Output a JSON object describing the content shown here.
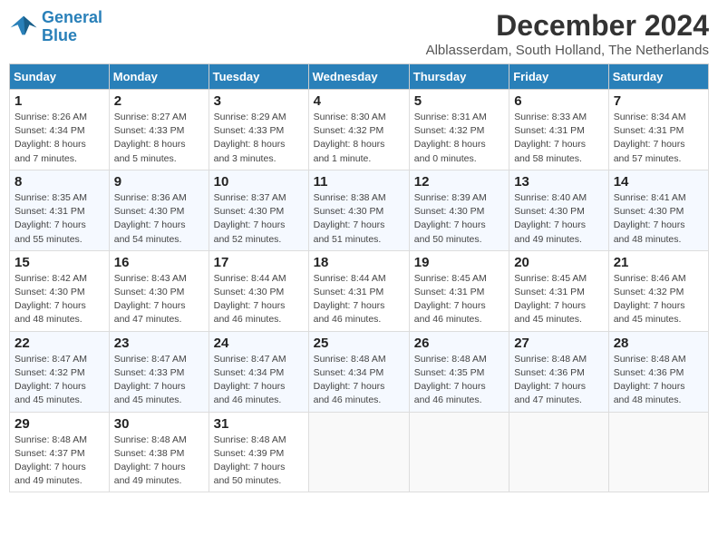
{
  "header": {
    "logo_line1": "General",
    "logo_line2": "Blue",
    "month_title": "December 2024",
    "subtitle": "Alblasserdam, South Holland, The Netherlands"
  },
  "weekdays": [
    "Sunday",
    "Monday",
    "Tuesday",
    "Wednesday",
    "Thursday",
    "Friday",
    "Saturday"
  ],
  "weeks": [
    [
      {
        "day": "1",
        "lines": [
          "Sunrise: 8:26 AM",
          "Sunset: 4:34 PM",
          "Daylight: 8 hours",
          "and 7 minutes."
        ]
      },
      {
        "day": "2",
        "lines": [
          "Sunrise: 8:27 AM",
          "Sunset: 4:33 PM",
          "Daylight: 8 hours",
          "and 5 minutes."
        ]
      },
      {
        "day": "3",
        "lines": [
          "Sunrise: 8:29 AM",
          "Sunset: 4:33 PM",
          "Daylight: 8 hours",
          "and 3 minutes."
        ]
      },
      {
        "day": "4",
        "lines": [
          "Sunrise: 8:30 AM",
          "Sunset: 4:32 PM",
          "Daylight: 8 hours",
          "and 1 minute."
        ]
      },
      {
        "day": "5",
        "lines": [
          "Sunrise: 8:31 AM",
          "Sunset: 4:32 PM",
          "Daylight: 8 hours",
          "and 0 minutes."
        ]
      },
      {
        "day": "6",
        "lines": [
          "Sunrise: 8:33 AM",
          "Sunset: 4:31 PM",
          "Daylight: 7 hours",
          "and 58 minutes."
        ]
      },
      {
        "day": "7",
        "lines": [
          "Sunrise: 8:34 AM",
          "Sunset: 4:31 PM",
          "Daylight: 7 hours",
          "and 57 minutes."
        ]
      }
    ],
    [
      {
        "day": "8",
        "lines": [
          "Sunrise: 8:35 AM",
          "Sunset: 4:31 PM",
          "Daylight: 7 hours",
          "and 55 minutes."
        ]
      },
      {
        "day": "9",
        "lines": [
          "Sunrise: 8:36 AM",
          "Sunset: 4:30 PM",
          "Daylight: 7 hours",
          "and 54 minutes."
        ]
      },
      {
        "day": "10",
        "lines": [
          "Sunrise: 8:37 AM",
          "Sunset: 4:30 PM",
          "Daylight: 7 hours",
          "and 52 minutes."
        ]
      },
      {
        "day": "11",
        "lines": [
          "Sunrise: 8:38 AM",
          "Sunset: 4:30 PM",
          "Daylight: 7 hours",
          "and 51 minutes."
        ]
      },
      {
        "day": "12",
        "lines": [
          "Sunrise: 8:39 AM",
          "Sunset: 4:30 PM",
          "Daylight: 7 hours",
          "and 50 minutes."
        ]
      },
      {
        "day": "13",
        "lines": [
          "Sunrise: 8:40 AM",
          "Sunset: 4:30 PM",
          "Daylight: 7 hours",
          "and 49 minutes."
        ]
      },
      {
        "day": "14",
        "lines": [
          "Sunrise: 8:41 AM",
          "Sunset: 4:30 PM",
          "Daylight: 7 hours",
          "and 48 minutes."
        ]
      }
    ],
    [
      {
        "day": "15",
        "lines": [
          "Sunrise: 8:42 AM",
          "Sunset: 4:30 PM",
          "Daylight: 7 hours",
          "and 48 minutes."
        ]
      },
      {
        "day": "16",
        "lines": [
          "Sunrise: 8:43 AM",
          "Sunset: 4:30 PM",
          "Daylight: 7 hours",
          "and 47 minutes."
        ]
      },
      {
        "day": "17",
        "lines": [
          "Sunrise: 8:44 AM",
          "Sunset: 4:30 PM",
          "Daylight: 7 hours",
          "and 46 minutes."
        ]
      },
      {
        "day": "18",
        "lines": [
          "Sunrise: 8:44 AM",
          "Sunset: 4:31 PM",
          "Daylight: 7 hours",
          "and 46 minutes."
        ]
      },
      {
        "day": "19",
        "lines": [
          "Sunrise: 8:45 AM",
          "Sunset: 4:31 PM",
          "Daylight: 7 hours",
          "and 46 minutes."
        ]
      },
      {
        "day": "20",
        "lines": [
          "Sunrise: 8:45 AM",
          "Sunset: 4:31 PM",
          "Daylight: 7 hours",
          "and 45 minutes."
        ]
      },
      {
        "day": "21",
        "lines": [
          "Sunrise: 8:46 AM",
          "Sunset: 4:32 PM",
          "Daylight: 7 hours",
          "and 45 minutes."
        ]
      }
    ],
    [
      {
        "day": "22",
        "lines": [
          "Sunrise: 8:47 AM",
          "Sunset: 4:32 PM",
          "Daylight: 7 hours",
          "and 45 minutes."
        ]
      },
      {
        "day": "23",
        "lines": [
          "Sunrise: 8:47 AM",
          "Sunset: 4:33 PM",
          "Daylight: 7 hours",
          "and 45 minutes."
        ]
      },
      {
        "day": "24",
        "lines": [
          "Sunrise: 8:47 AM",
          "Sunset: 4:34 PM",
          "Daylight: 7 hours",
          "and 46 minutes."
        ]
      },
      {
        "day": "25",
        "lines": [
          "Sunrise: 8:48 AM",
          "Sunset: 4:34 PM",
          "Daylight: 7 hours",
          "and 46 minutes."
        ]
      },
      {
        "day": "26",
        "lines": [
          "Sunrise: 8:48 AM",
          "Sunset: 4:35 PM",
          "Daylight: 7 hours",
          "and 46 minutes."
        ]
      },
      {
        "day": "27",
        "lines": [
          "Sunrise: 8:48 AM",
          "Sunset: 4:36 PM",
          "Daylight: 7 hours",
          "and 47 minutes."
        ]
      },
      {
        "day": "28",
        "lines": [
          "Sunrise: 8:48 AM",
          "Sunset: 4:36 PM",
          "Daylight: 7 hours",
          "and 48 minutes."
        ]
      }
    ],
    [
      {
        "day": "29",
        "lines": [
          "Sunrise: 8:48 AM",
          "Sunset: 4:37 PM",
          "Daylight: 7 hours",
          "and 49 minutes."
        ]
      },
      {
        "day": "30",
        "lines": [
          "Sunrise: 8:48 AM",
          "Sunset: 4:38 PM",
          "Daylight: 7 hours",
          "and 49 minutes."
        ]
      },
      {
        "day": "31",
        "lines": [
          "Sunrise: 8:48 AM",
          "Sunset: 4:39 PM",
          "Daylight: 7 hours",
          "and 50 minutes."
        ]
      },
      null,
      null,
      null,
      null
    ]
  ]
}
